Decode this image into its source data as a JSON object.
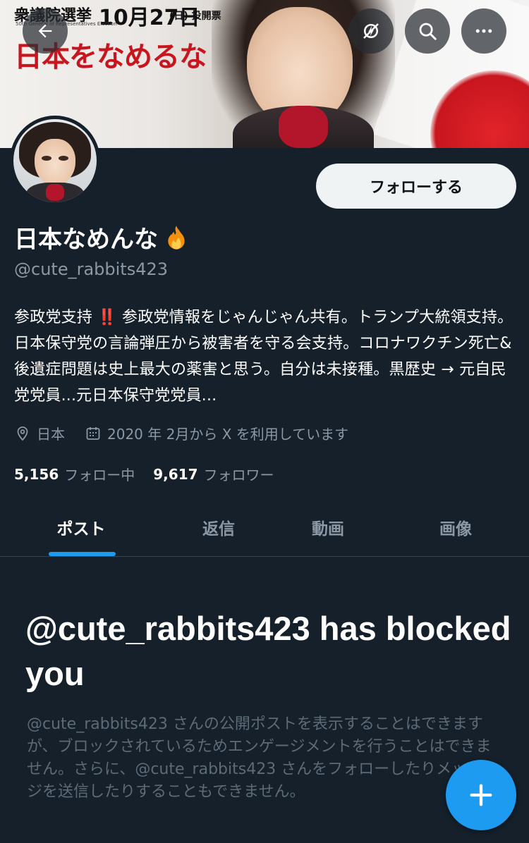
{
  "banner": {
    "election_title": "衆議院選挙",
    "election_date": "10月27日",
    "election_vote": "(日) 投開票",
    "election_sub": "50th General of Representatives Election",
    "slogan": "日本をなめるな"
  },
  "header_icons": [
    "arrow-left-icon",
    "bolt-off-icon",
    "search-icon",
    "more-icon"
  ],
  "profile": {
    "display_name": "日本なめんな",
    "handle": "@cute_rabbits423",
    "follow_button": "フォローする",
    "bio_part1": "参政党支持",
    "bio_excl": "‼️",
    "bio_part2": "参政党情報をじゃんじゃん共有。トランプ大統領支持。日本保守党の言論弾圧から被害者を守る会支持。コロナワクチン死亡&後遺症問題は史上最大の薬害と思う。自分は未接種。黒歴史 → 元自民党党員...元日本保守党党員...",
    "location": "日本",
    "joined": "2020 年 2月から X を利用しています",
    "following_count": "5,156",
    "following_label": "フォロー中",
    "followers_count": "9,617",
    "followers_label": "フォロワー"
  },
  "tabs": [
    {
      "label": "ポスト",
      "active": true
    },
    {
      "label": "返信",
      "active": false
    },
    {
      "label": "動画",
      "active": false
    },
    {
      "label": "画像",
      "active": false
    }
  ],
  "blocked": {
    "title": "@cute_rabbits423 has blocked you",
    "description": "@cute_rabbits423 さんの公開ポストを表示することはできますが、ブロックされているためエンゲージメントを行うことはできません。さらに、@cute_rabbits423 さんをフォローしたりメッセージを送信したりすることもできません。"
  },
  "colors": {
    "background": "#15202b",
    "accent": "#1d9bf0",
    "muted_text": "#8b98a5"
  }
}
